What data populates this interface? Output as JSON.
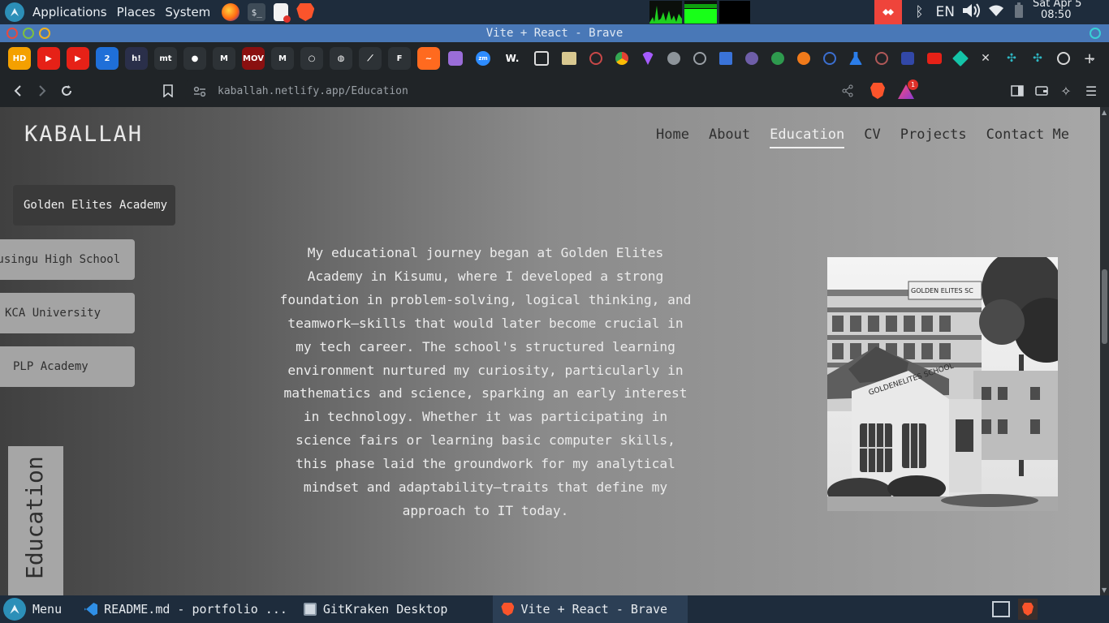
{
  "os_panel": {
    "menu_items": [
      "Applications",
      "Places",
      "System"
    ],
    "keyboard_layout": "EN",
    "clock_day": "Sat Apr  5",
    "clock_time": "08:50"
  },
  "window": {
    "title": "Vite + React - Brave"
  },
  "browser": {
    "url_host": "kaballah.netlify.app",
    "url_path": "/Education",
    "notification_count": "1"
  },
  "bookmarks": [
    {
      "icon": "hd-icon",
      "text": "HD",
      "bg": "#f4a000"
    },
    {
      "icon": "youtube-icon",
      "text": "▶",
      "bg": "#e62117"
    },
    {
      "icon": "youtube-icon",
      "text": "▶",
      "bg": "#e62117"
    },
    {
      "icon": "two-icon",
      "text": "2",
      "bg": "#1f6fd8"
    },
    {
      "icon": "hashnode-icon",
      "text": "h!",
      "bg": "#2a2f4a"
    },
    {
      "icon": "mt-icon",
      "text": "mt",
      "bg": "#2d3236"
    },
    {
      "icon": "github-icon",
      "text": "●",
      "bg": "#2d3236"
    },
    {
      "icon": "gmail-icon",
      "text": "M",
      "bg": "#2d3236"
    },
    {
      "icon": "movie-icon",
      "text": "MOV",
      "bg": "#8a1010"
    },
    {
      "icon": "gmail-icon",
      "text": "M",
      "bg": "#2d3236"
    },
    {
      "icon": "circle-icon",
      "text": "○",
      "bg": "#2d3236"
    },
    {
      "icon": "globe-icon",
      "text": "◍",
      "bg": "#2d3236"
    },
    {
      "icon": "feather-icon",
      "text": "⟋",
      "bg": "#2d3236"
    },
    {
      "icon": "framer-icon",
      "text": "F",
      "bg": "#2d3236"
    },
    {
      "icon": "wave-icon",
      "text": "~",
      "bg": "#ff6a1f"
    }
  ],
  "site": {
    "logo": "KABALLAH",
    "nav": [
      "Home",
      "About",
      "Education",
      "CV",
      "Projects",
      "Contact Me"
    ],
    "active_nav": "Education",
    "schools": [
      "Golden Elites Academy",
      "Musingu High School",
      "KCA University",
      "PLP Academy"
    ],
    "side_label": "Education",
    "paragraph": "My educational journey began at Golden Elites Academy in Kisumu, where I developed a strong foundation in problem-solving, logical thinking, and teamwork—skills that would later become crucial in my tech career. The school's structured learning environment nurtured my curiosity, particularly in mathematics and science, sparking an early interest in technology. Whether it was participating in science fairs or learning basic computer skills, this phase laid the groundwork for my analytical mindset and adaptability—traits that define my approach to IT today.",
    "photo_sign_1": "GOLDEN ELITES SC",
    "photo_sign_2": "GOLDENELITES SCHOOL"
  },
  "taskbar": {
    "menu_label": "Menu",
    "tasks": [
      "README.md - portfolio ...",
      "GitKraken Desktop",
      "Vite + React - Brave"
    ]
  },
  "colors": {
    "os_panel": "#1e2c3c",
    "titlebar": "#4978b7",
    "browser_chrome": "#202427",
    "brave_orange": "#fb542b"
  }
}
